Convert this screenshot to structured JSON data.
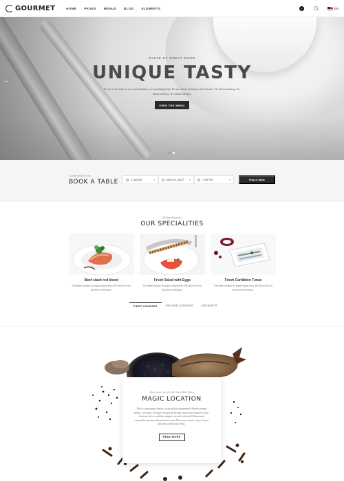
{
  "header": {
    "logo": "GOURMET",
    "nav": [
      "HOME",
      "PAGES",
      "MENUS",
      "BLOG",
      "ELEMENTS"
    ],
    "cart_count": "0",
    "lang": "EN"
  },
  "hero": {
    "eyebrow": "TASTE OF GREAT FOOD",
    "title": "UNIQUE TASTY",
    "description": "Food, in the end, in our own tradition, is something holy. It's not about nutrients and calories. It's about sharing. It's about honesty. It's about identity.",
    "button": "VIEW THE MENU",
    "slides": 2,
    "active_slide": 2
  },
  "booking": {
    "eyebrow": "A table only for you",
    "title": "BOOK A TABLE",
    "persons": "1 person",
    "date": "May 24, 2017",
    "time": "7:30 PM",
    "button": "Find a Table"
  },
  "specialities": {
    "eyebrow": "Divine flavours",
    "title": "OUR SPECIALITIES",
    "items": [
      {
        "name": "Beef stack red blood",
        "desc": "Tincidunt integer eu augue augue nunc elit dolore luctus placerat scelerisque."
      },
      {
        "name": "Fresh Salad with Eggs",
        "desc": "Tincidunt integer eu augue augue nunc elit dolore luctus placerat scelerisque."
      },
      {
        "name": "Fresh Caribbien Tunas",
        "desc": "Tincidunt integer eu augue augue nunc elit dolore luctus placerat scelerisque."
      }
    ],
    "tabs": [
      "FIRST COURSES",
      "SECOND COURSES",
      "DESSERTS"
    ]
  },
  "location": {
    "eyebrow": "Open your eyes for this incredible place",
    "title": "MAGIC LOCATION",
    "description": "Dolor consequatur mauris, risus mattis tempeammil dibenti semant ipsum, arcu nunc tristique suscipit perferendis proin non feugiat facilisi, deserunt dolor curabitur, magna sem nisl vehicula Ullamcorper suspendisse perferendis pretium lacinia Maecenas cursus viverra luctus placerat scelerisque tellus.",
    "button": "READ MORE"
  }
}
